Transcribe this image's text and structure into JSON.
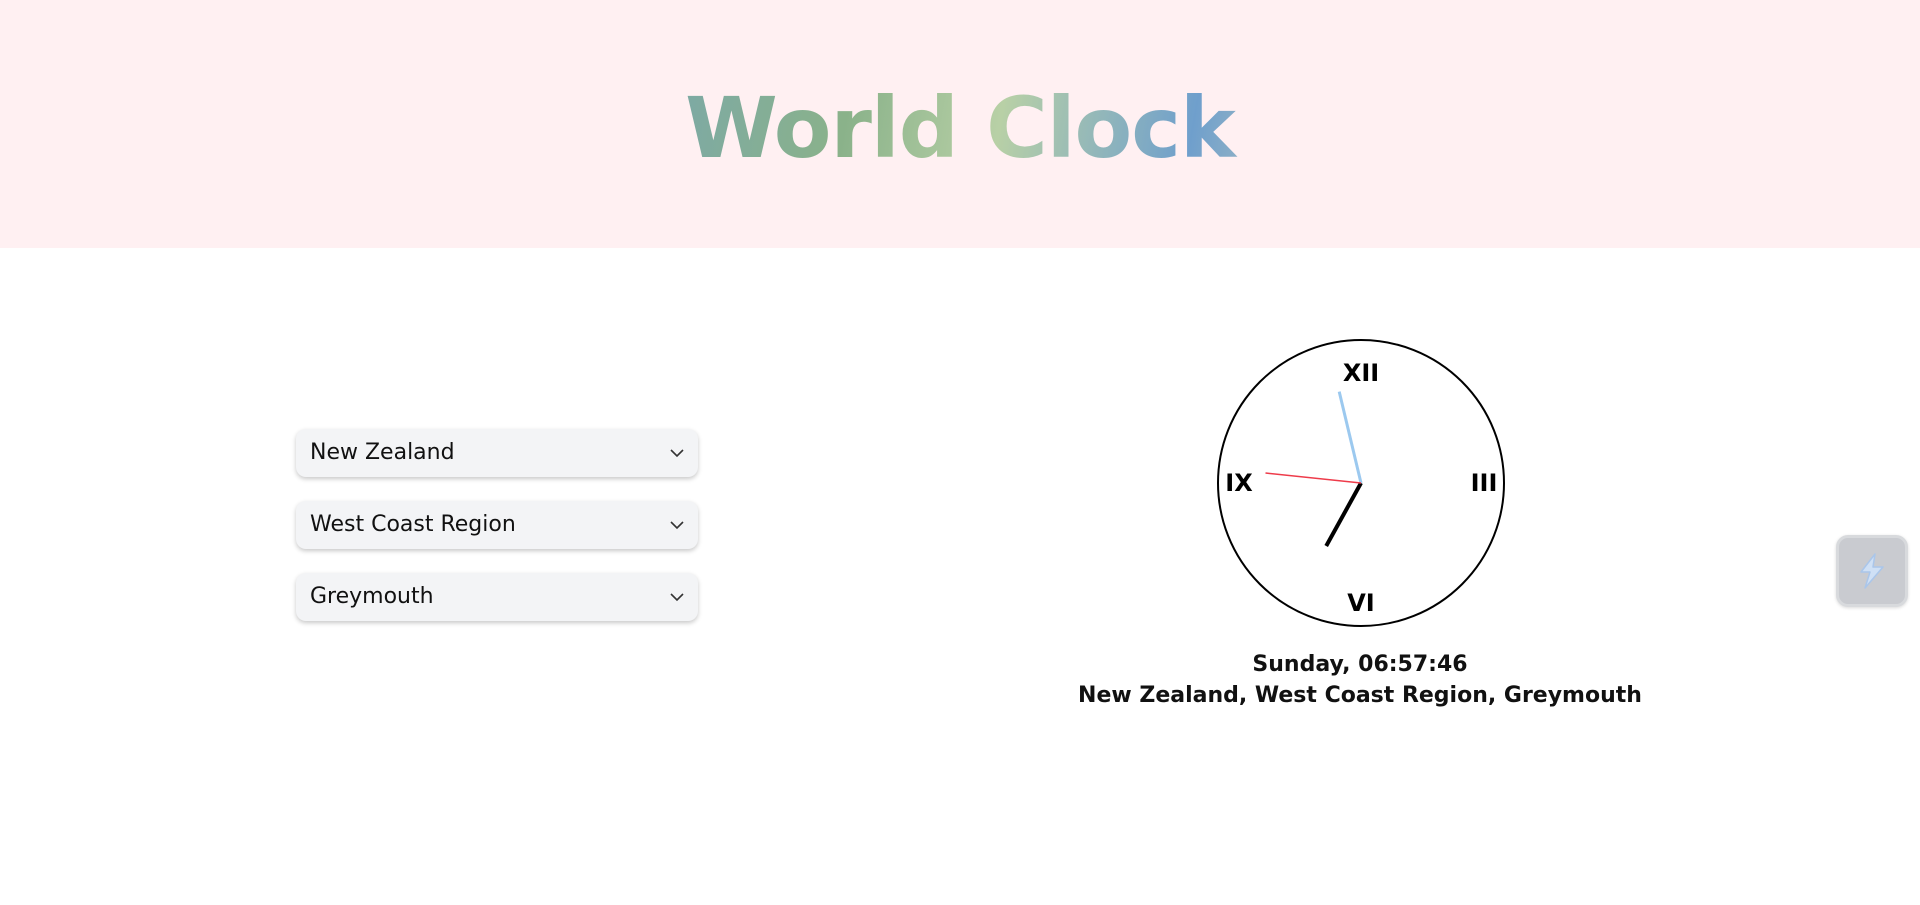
{
  "header": {
    "title": "World Clock"
  },
  "selectors": {
    "country": "New Zealand",
    "region": "West Coast Region",
    "city": "Greymouth"
  },
  "clock": {
    "numerals": {
      "twelve": "XII",
      "three": "III",
      "six": "VI",
      "nine": "IX"
    },
    "time": {
      "hours": 6,
      "minutes": 57,
      "seconds": 46
    },
    "colors": {
      "hour_hand": "#000000",
      "minute_hand": "#9cc9ef",
      "second_hand": "#ee3b4a"
    }
  },
  "readout": {
    "datetime": "Sunday, 06:57:46",
    "location": "New Zealand, West Coast Region, Greymouth"
  },
  "side_button": {
    "icon": "lightning-bolt-icon"
  }
}
